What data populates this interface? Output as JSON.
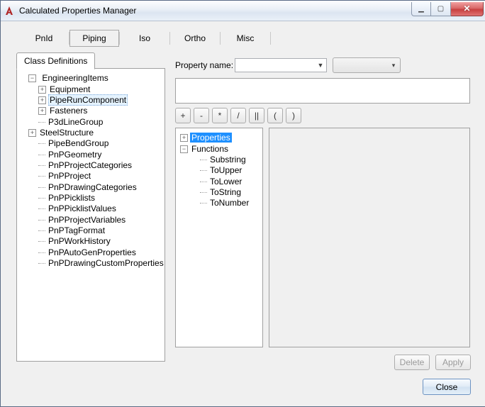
{
  "window": {
    "title": "Calculated Properties Manager"
  },
  "tabs": {
    "items": [
      "PnId",
      "Piping",
      "Iso",
      "Ortho",
      "Misc"
    ],
    "active_index": 1
  },
  "class_def": {
    "header": "Class Definitions",
    "root": "EngineeringItems",
    "root_children": [
      "Equipment",
      "PipeRunComponent",
      "Fasteners"
    ],
    "selected": "PipeRunComponent",
    "siblings": [
      "P3dLineGroup",
      "SteelStructure",
      "PipeBendGroup",
      "PnPGeometry",
      "PnPProjectCategories",
      "PnPProject",
      "PnPDrawingCategories",
      "PnPPicklists",
      "PnPPicklistValues",
      "PnPProjectVariables",
      "PnPTagFormat",
      "PnPWorkHistory",
      "PnPAutoGenProperties",
      "PnPDrawingCustomProperties"
    ],
    "sibling_expandable": {
      "SteelStructure": true
    }
  },
  "right": {
    "property_name_label": "Property name:",
    "property_name_value": "",
    "operators": [
      "+",
      "-",
      "*",
      "/",
      "||",
      "(",
      ")"
    ],
    "tree": {
      "root1": "Properties",
      "root2": "Functions",
      "functions": [
        "Substring",
        "ToUpper",
        "ToLower",
        "ToString",
        "ToNumber"
      ]
    },
    "buttons": {
      "delete": "Delete",
      "apply": "Apply",
      "close": "Close"
    }
  }
}
